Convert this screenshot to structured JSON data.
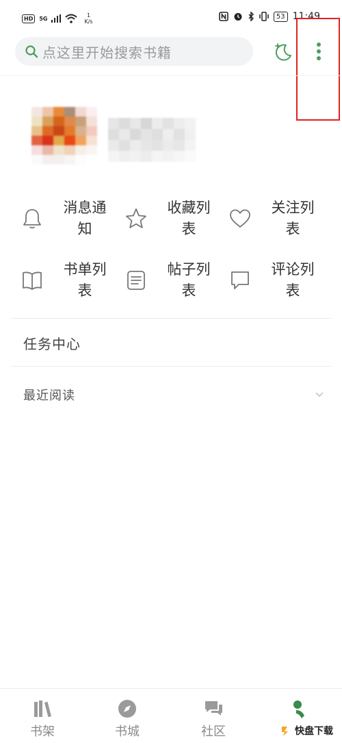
{
  "status_bar": {
    "hd_label": "HD",
    "network": "5G",
    "speed_value": "1",
    "speed_unit": "K/s",
    "battery": "53",
    "time": "11:49"
  },
  "search": {
    "placeholder": "点这里开始搜索书籍"
  },
  "colors": {
    "accent": "#4a9e5c",
    "highlight": "#e02020"
  },
  "features": [
    {
      "label": "消息通知",
      "icon": "bell-icon"
    },
    {
      "label": "收藏列表",
      "icon": "star-icon"
    },
    {
      "label": "关注列表",
      "icon": "heart-icon"
    },
    {
      "label": "书单列表",
      "icon": "book-icon"
    },
    {
      "label": "帖子列表",
      "icon": "note-icon"
    },
    {
      "label": "评论列表",
      "icon": "comment-icon"
    }
  ],
  "task_center": "任务中心",
  "recent_read": "最近阅读",
  "bottom_nav": [
    {
      "label": "书架",
      "icon": "bookshelf-icon"
    },
    {
      "label": "书城",
      "icon": "compass-icon"
    },
    {
      "label": "社区",
      "icon": "chat-icon"
    },
    {
      "label": "",
      "icon": "profile-icon"
    }
  ],
  "watermark": {
    "brand": "快盘下载"
  }
}
